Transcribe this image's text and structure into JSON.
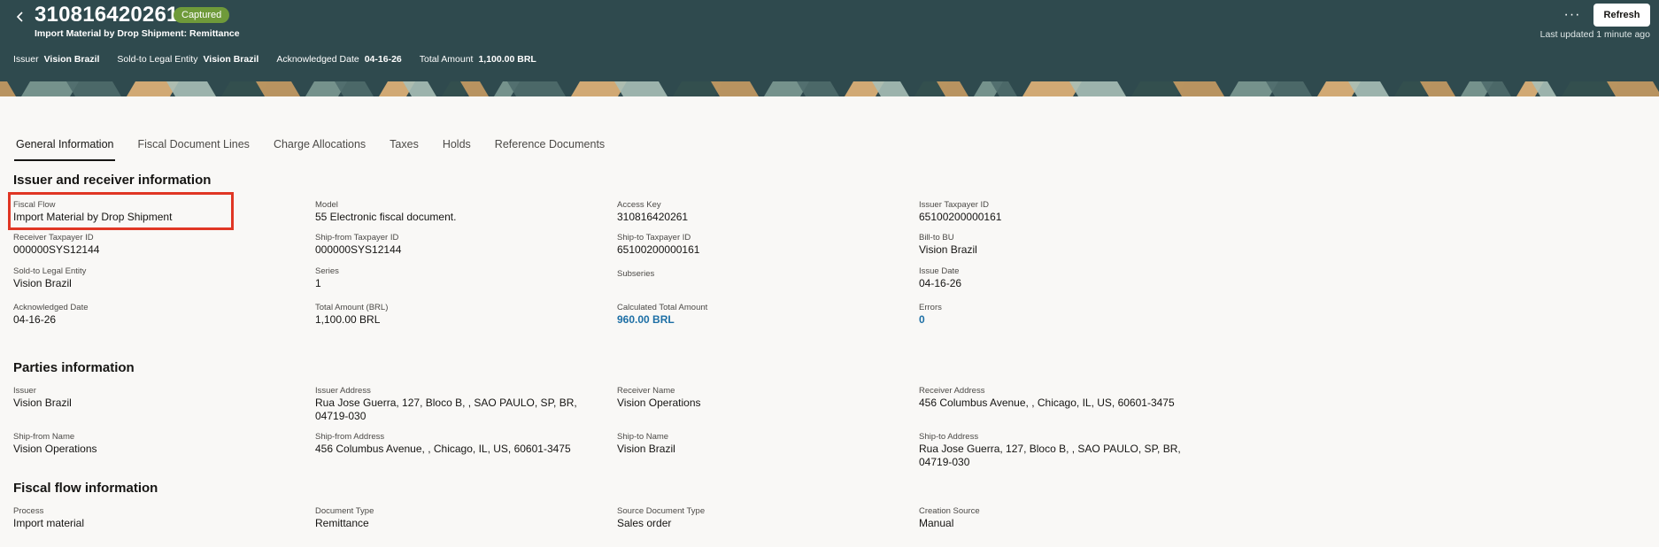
{
  "header": {
    "title": "310816420261",
    "status": "Captured",
    "subtitle": "Import Material by Drop Shipment: Remittance",
    "meta": [
      {
        "key": "Issuer",
        "value": "Vision Brazil"
      },
      {
        "key": "Sold-to Legal Entity",
        "value": "Vision Brazil"
      },
      {
        "key": "Acknowledged Date",
        "value": "04-16-26"
      },
      {
        "key": "Total Amount",
        "value": "1,100.00 BRL"
      }
    ],
    "refresh_label": "Refresh",
    "more_icon": "···",
    "last_updated": "Last updated 1 minute ago"
  },
  "tabs": [
    "General Information",
    "Fiscal Document Lines",
    "Charge Allocations",
    "Taxes",
    "Holds",
    "Reference Documents"
  ],
  "issuer_receiver": {
    "title": "Issuer and receiver information",
    "fields": [
      {
        "label": "Fiscal Flow",
        "value": "Import Material by Drop Shipment"
      },
      {
        "label": "Model",
        "value": "55 Electronic fiscal document."
      },
      {
        "label": "Access Key",
        "value": "310816420261"
      },
      {
        "label": "Issuer Taxpayer ID",
        "value": "65100200000161"
      },
      {
        "label": "Receiver Taxpayer ID",
        "value": "000000SYS12144"
      },
      {
        "label": "Ship-from Taxpayer ID",
        "value": "000000SYS12144"
      },
      {
        "label": "Ship-to Taxpayer ID",
        "value": "65100200000161"
      },
      {
        "label": "Bill-to BU",
        "value": "Vision Brazil"
      },
      {
        "label": "Sold-to Legal Entity",
        "value": "Vision Brazil"
      },
      {
        "label": "Series",
        "value": "1"
      },
      {
        "label": "Subseries",
        "value": ""
      },
      {
        "label": "Issue Date",
        "value": "04-16-26"
      },
      {
        "label": "Acknowledged Date",
        "value": "04-16-26"
      },
      {
        "label": "Total Amount (BRL)",
        "value": "1,100.00 BRL"
      },
      {
        "label": "Calculated Total Amount",
        "value": "960.00 BRL"
      },
      {
        "label": "Errors",
        "value": "0"
      }
    ]
  },
  "parties": {
    "title": "Parties information",
    "fields": [
      {
        "label": "Issuer",
        "value": "Vision Brazil"
      },
      {
        "label": "Issuer Address",
        "value": "Rua Jose Guerra, 127, Bloco B, , SAO PAULO, SP, BR, 04719-030"
      },
      {
        "label": "Receiver Name",
        "value": "Vision Operations"
      },
      {
        "label": "Receiver Address",
        "value": "456 Columbus Avenue, , Chicago, IL, US, 60601-3475"
      },
      {
        "label": "Ship-from Name",
        "value": "Vision Operations"
      },
      {
        "label": "Ship-from Address",
        "value": "456 Columbus Avenue, , Chicago, IL, US, 60601-3475"
      },
      {
        "label": "Ship-to Name",
        "value": "Vision Brazil"
      },
      {
        "label": "Ship-to Address",
        "value": "Rua Jose Guerra, 127, Bloco B, , SAO PAULO, SP, BR, 04719-030"
      }
    ]
  },
  "fiscal_flow": {
    "title": "Fiscal flow information",
    "fields": [
      {
        "label": "Process",
        "value": "Import material"
      },
      {
        "label": "Document Type",
        "value": "Remittance"
      },
      {
        "label": "Source Document Type",
        "value": "Sales order"
      },
      {
        "label": "Creation Source",
        "value": "Manual"
      }
    ]
  },
  "colors": {
    "header_bg": "#2f4a4e",
    "badge_bg": "#6f9a3a",
    "link": "#1d6fa5",
    "highlight": "#e03624"
  }
}
